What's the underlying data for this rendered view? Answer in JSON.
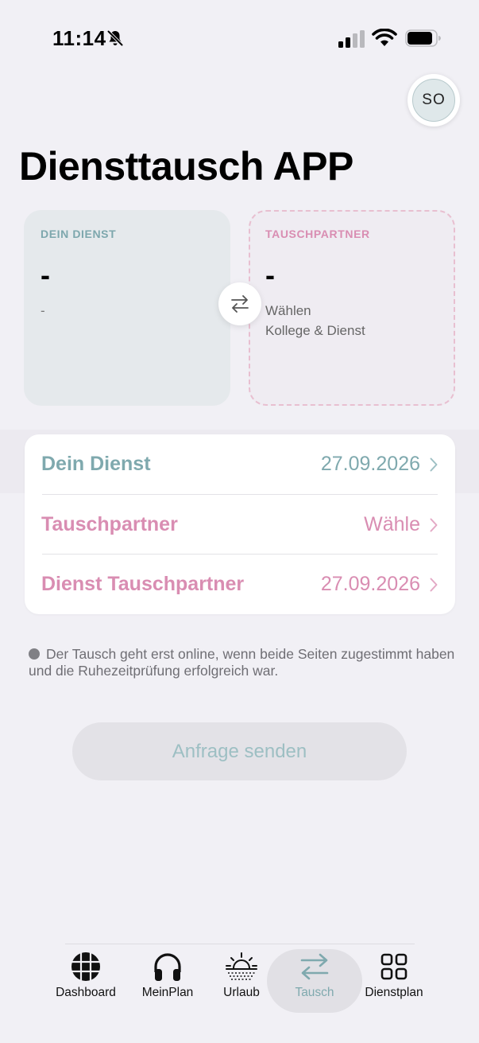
{
  "status_bar": {
    "time": "11:14",
    "icons": [
      "bell-slash-icon",
      "cellular-signal-icon",
      "wifi-icon",
      "battery-icon"
    ]
  },
  "header": {
    "avatar_initials": "SO",
    "title": "Diensttausch APP"
  },
  "cards": {
    "mine": {
      "label": "DEIN DIENST",
      "value": "-",
      "sub": "-"
    },
    "partner": {
      "label": "TAUSCHPARTNER",
      "value": "-",
      "sub_line1": "Wählen",
      "sub_line2": "Kollege & Dienst"
    },
    "swap_icon": "swap-arrows-icon"
  },
  "selection_list": [
    {
      "label": "Dein Dienst",
      "value": "27.09.2026"
    },
    {
      "label": "Tauschpartner",
      "value": "Wähle"
    },
    {
      "label": "Dienst Tauschpartner",
      "value": "27.09.2026"
    }
  ],
  "info_note": "Der Tausch geht erst online, wenn beide Seiten zugestimmt haben und die Ruhezeitprüfung erfolgreich war.",
  "send_button": {
    "label": "Anfrage senden"
  },
  "tabbar": {
    "active": "Tausch",
    "items": [
      {
        "label": "Dashboard",
        "icon": "globe-icon"
      },
      {
        "label": "MeinPlan",
        "icon": "headphones-icon"
      },
      {
        "label": "Urlaub",
        "icon": "sunrise-icon"
      },
      {
        "label": "Tausch",
        "icon": "swap-arrows-icon"
      },
      {
        "label": "Dienstplan",
        "icon": "grid-icon"
      }
    ]
  },
  "colors": {
    "accent_teal": "#7fa9ae",
    "accent_pink": "#d98db2",
    "background": "#f1f0f5"
  }
}
